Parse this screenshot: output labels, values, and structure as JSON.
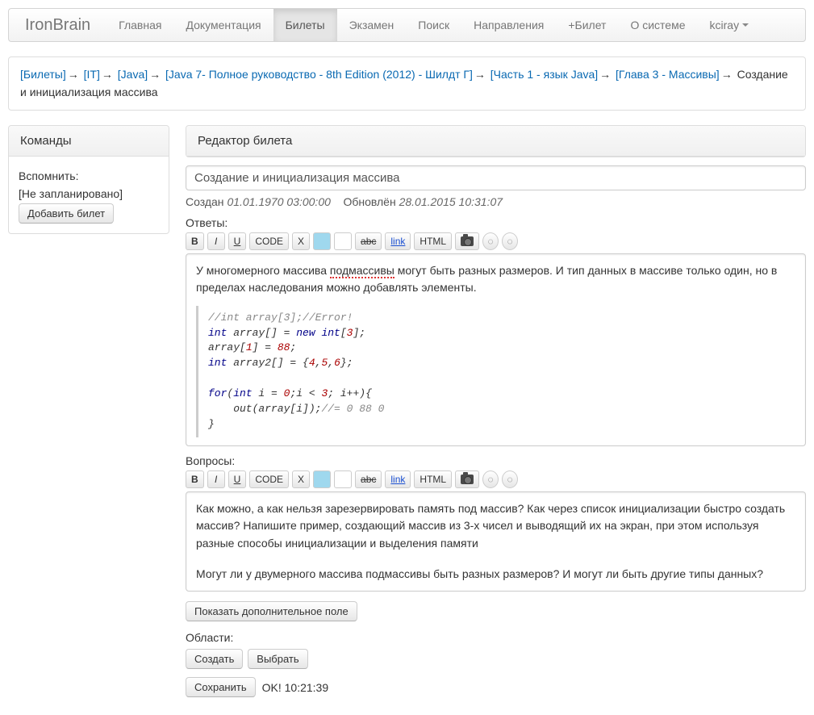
{
  "brand": "IronBrain",
  "nav": {
    "items": [
      "Главная",
      "Документация",
      "Билеты",
      "Экзамен",
      "Поиск",
      "Направления",
      "+Билет",
      "О системе"
    ],
    "active_index": 2,
    "user": "kciray"
  },
  "breadcrumb": {
    "items": [
      "[Билеты]",
      "[IT]",
      "[Java]",
      "[Java 7- Полное руководство - 8th Edition (2012) - Шилдт Г]",
      "[Часть 1 - язык Java]",
      "[Глава 3 - Массивы]"
    ],
    "tail": "Создание и инициализация массива",
    "sep": "→"
  },
  "sidebar": {
    "title": "Команды",
    "remind_label": "Вспомнить:",
    "remind_value": "[Не запланировано]",
    "add_ticket": "Добавить билет"
  },
  "editor": {
    "title": "Редактор билета",
    "ticket_name": "Создание и инициализация массива",
    "created_label": "Создан",
    "created_value": "01.01.1970 03:00:00",
    "updated_label": "Обновлён",
    "updated_value": "28.01.2015 10:31:07",
    "answers_label": "Ответы:",
    "questions_label": "Вопросы:",
    "toolbar": {
      "bold": "B",
      "italic": "I",
      "underline": "U",
      "code": "CODE",
      "x": "X",
      "strike": "abc",
      "link": "link",
      "html": "HTML",
      "ball1": "◌",
      "ball2": "◌"
    },
    "answer": {
      "p1a": "У многомерного массива ",
      "p1b": "подмассивы",
      "p1c": " могут быть разных размеров. И тип данных в массиве только один, но в пределах наследования можно добавлять элементы.",
      "code": "//int array[3];//Error!\nint array[] = new int[3];\narray[1] = 88;\nint array2[] = {4,5,6};\n\nfor(int i = 0;i < 3; i++){\n    out(array[i]);//= 0 88 0\n}"
    },
    "question": {
      "p1": "Как можно, а как нельзя зарезервировать память под массив? Как через список инициализации быстро создать массив? Напишите пример, создающий массив из 3-х чисел и выводящий их на экран, при этом используя разные способы инициализации и выделения памяти",
      "p2": "Могут ли у двумерного массива подмассивы быть разных размеров? И могут ли быть другие типы данных?"
    },
    "show_extra": "Показать дополнительное поле",
    "areas_label": "Области:",
    "create_btn": "Создать",
    "select_btn": "Выбрать",
    "save_btn": "Сохранить",
    "status": "OK! 10:21:39"
  }
}
